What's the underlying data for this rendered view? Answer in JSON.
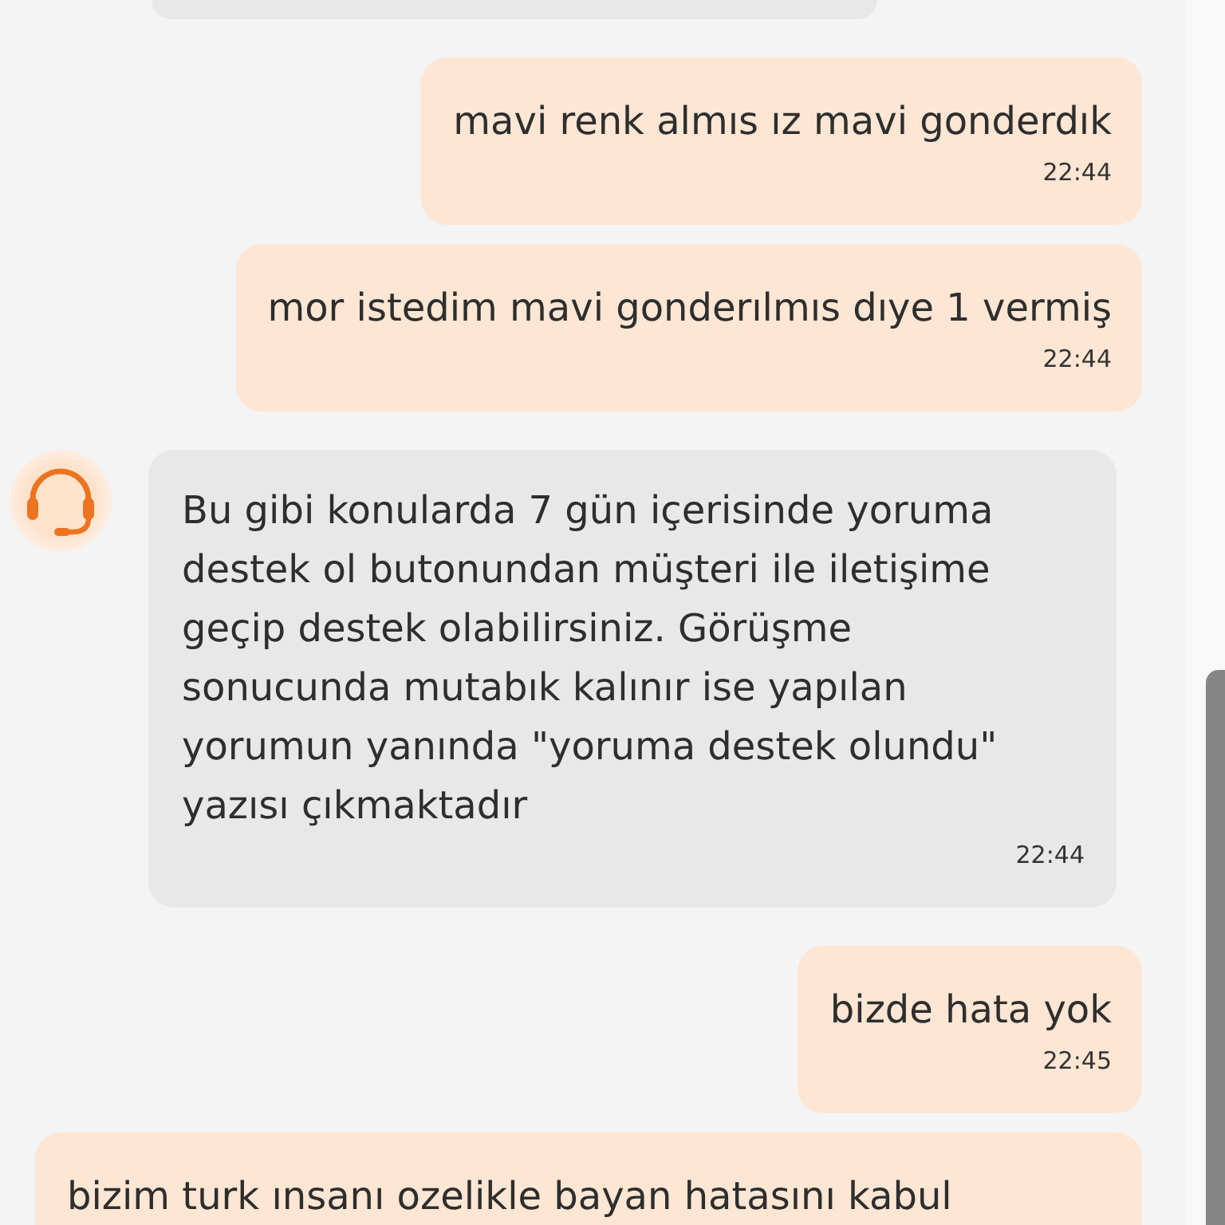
{
  "messages": [
    {
      "kind": "incoming",
      "avatar": false,
      "cut_off": true
    },
    {
      "kind": "outgoing",
      "avatar": false,
      "cut_off": false,
      "text": "mavi renk almıs ız mavi gonderdık",
      "time": "22:44"
    },
    {
      "kind": "outgoing",
      "avatar": false,
      "cut_off": false,
      "text": "mor istedim mavi gonderılmıs dıye 1 vermiş",
      "time": "22:44"
    },
    {
      "kind": "incoming",
      "avatar": true,
      "cut_off": false,
      "text": "Bu gibi konularda 7 gün içerisinde yoruma destek ol butonundan müşteri ile iletişime geçip destek olabilirsiniz. Görüşme sonucunda mutabık kalınır ise yapılan yorumun yanında \"yoruma destek olundu\" yazısı çıkmaktadır",
      "time": "22:44"
    },
    {
      "kind": "outgoing",
      "avatar": false,
      "cut_off": false,
      "text": "bizde hata yok",
      "time": "22:45"
    },
    {
      "kind": "outgoing",
      "avatar": false,
      "cut_off": true,
      "text": "bizim turk ınsanı ozelikle bayan hatasını kabul"
    }
  ]
}
